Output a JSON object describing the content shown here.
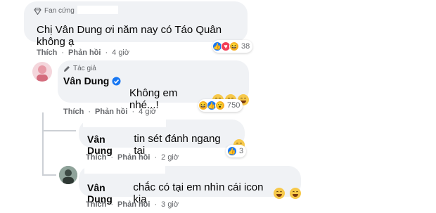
{
  "comment1": {
    "badge": "Fan cứng",
    "text": "Chị Vân Dung ơi năm nay có Táo Quân không ạ",
    "like": "Thích",
    "reply": "Phản hồi",
    "time": "4 giờ",
    "reaction_count": "38"
  },
  "comment2": {
    "badge": "Tác giả",
    "name": "Vân Dung",
    "text": "Không em nhé...!",
    "like": "Thích",
    "reply": "Phản hồi",
    "time": "4 giờ",
    "reaction_count": "750"
  },
  "comment3": {
    "tag": "Vân Dung",
    "text": "tin sét đánh ngang tai",
    "like": "Thích",
    "reply": "Phản hồi",
    "time": "2 giờ",
    "reaction_count": "3"
  },
  "comment4": {
    "tag": "Vân Dung",
    "text": "chắc có tại em nhìn cái icon kia",
    "like": "Thích",
    "reply": "Phản hồi",
    "time": "3 giờ"
  },
  "separator": "·",
  "colors": {
    "bubble": "#f0f2f5",
    "meta": "#65676b",
    "like": "#1877f2",
    "love": "#f33e58",
    "haha": "#f7b125"
  }
}
